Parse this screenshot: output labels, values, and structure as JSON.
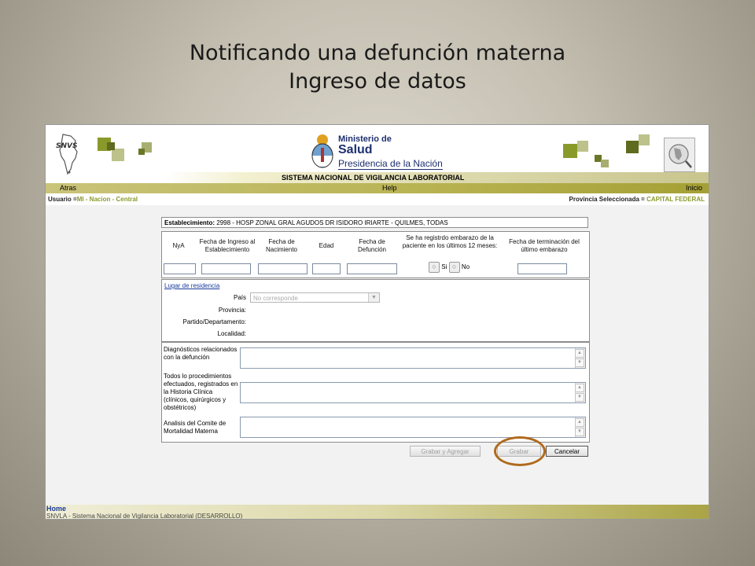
{
  "slide": {
    "title_line1": "Notificando una defunción materna",
    "title_line2": "Ingreso de datos"
  },
  "header": {
    "snvs_logo_text": "SNVS",
    "ministerio": "Ministerio de",
    "salud": "Salud",
    "presidencia": "Presidencia de la Nación",
    "system_name": "SISTEMA NACIONAL DE VIGILANCIA LABORATORIAL"
  },
  "nav": {
    "back": "Atras",
    "help": "Help",
    "home": "Inicio"
  },
  "user_bar": {
    "user_label": "Usuario =",
    "user_value": "MI - Nacion - Central",
    "province_label": "Provincia Seleccionada =",
    "province_value": "CAPITAL FEDERAL"
  },
  "form": {
    "establecimiento_label": "Establecimiento:",
    "establecimiento_value": "2998 - HOSP ZONAL GRAL AGUDOS DR ISIDORO IRIARTE - QUILMES, TODAS",
    "columns": {
      "nya": "NyA",
      "fecha_ingreso": "Fecha de Ingreso al Establecimiento",
      "fecha_nacimiento": "Fecha de Nacimiento",
      "edad": "Edad",
      "fecha_defuncion": "Fecha de Defunción",
      "embarazo": "Se ha registrdo embarazo de la paciente en los últimos 12 meses:",
      "fecha_terminacion": "Fecha de terminación del último embarazo"
    },
    "radio_si": "Si",
    "radio_no": "No",
    "residencia": {
      "section_link": "Lugar de residencia",
      "pais_label": "País",
      "pais_value": "No corresponde",
      "provincia_label": "Provincia:",
      "partido_label": "Partido/Departamento:",
      "localidad_label": "Localidad:"
    },
    "diagnosticos_label": "Diagnósticos relacionados con la defunción",
    "procedimientos_label": "Todos lo procedimientos efectuados, registrados en la Historia Clínica (clínicos, quirúrgicos y obstétricos)",
    "analisis_label": "Analisis del Comite de Mortalidad Materna",
    "buttons": {
      "grabar_agregar": "Grabar y Agregar",
      "grabar": "Grabar",
      "cancelar": "Cancelar"
    }
  },
  "footer": {
    "home_link": "Home",
    "text": "SNVLA - Sistema Nacional de Vigilancia Laboratorial (DESARROLLO)"
  },
  "colors": {
    "accent_olive": "#b7b250",
    "highlight_circle": "#b06a1c",
    "ministry_blue": "#1d2f6f",
    "user_value_green": "#8a9a2a"
  }
}
